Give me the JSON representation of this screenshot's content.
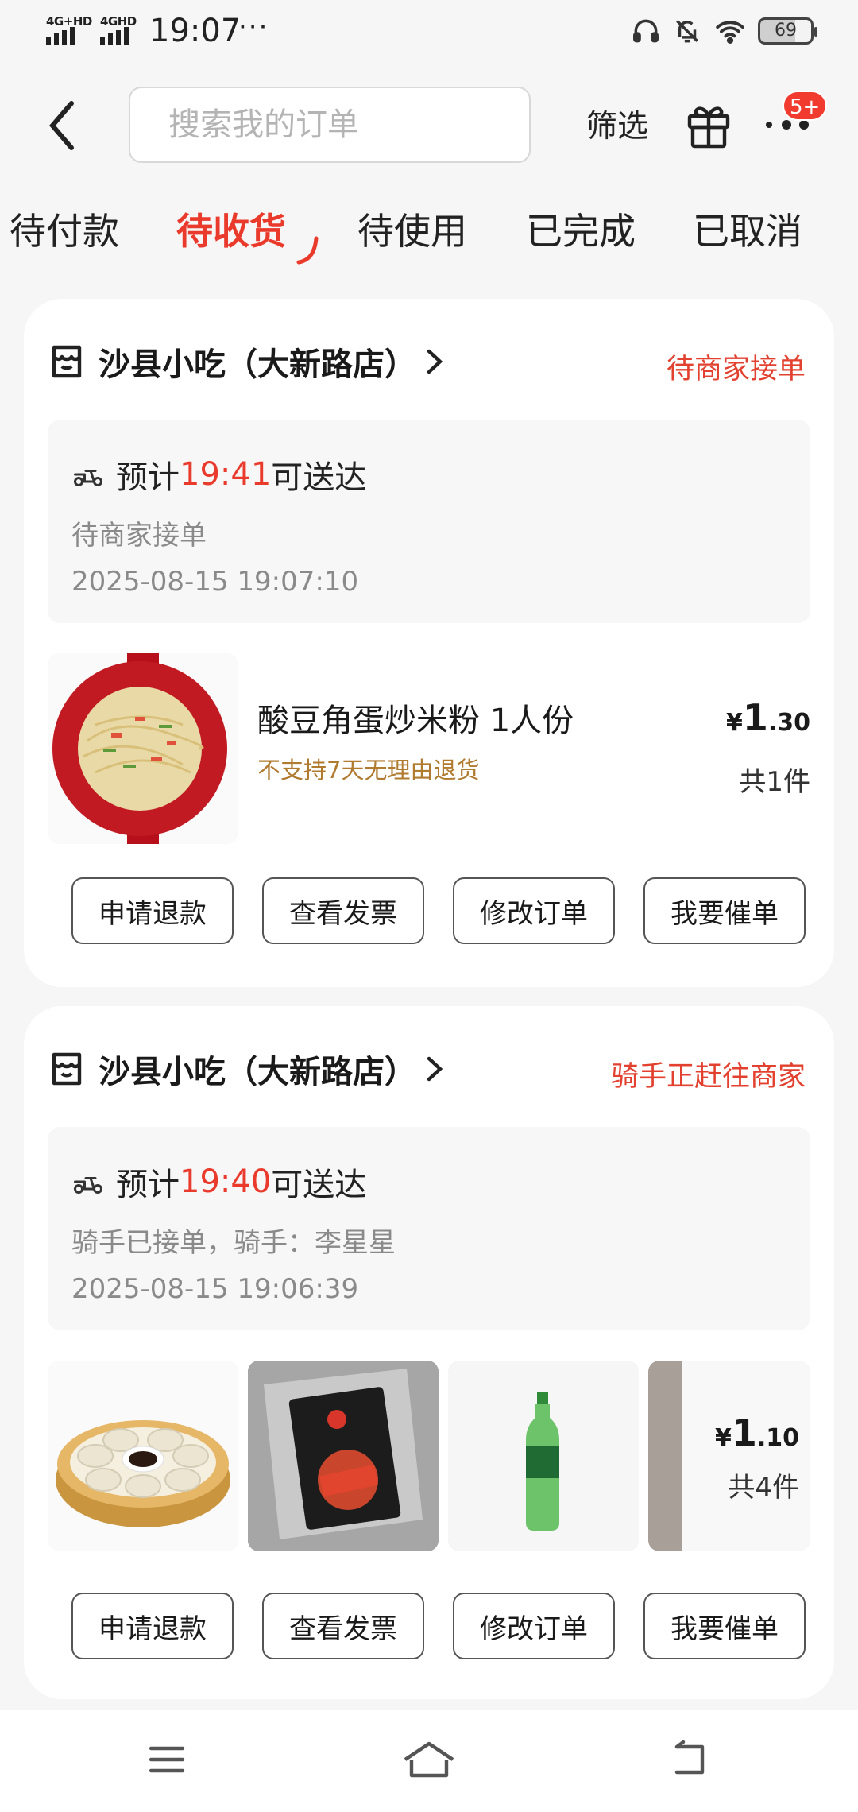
{
  "status_bar": {
    "network1": "4G+HD",
    "network2": "4GHD",
    "time": "19:07",
    "more": "···",
    "battery": "69",
    "battery_level": 0.69,
    "icons": [
      "headphones-icon",
      "bell-off-icon",
      "wifi-icon",
      "battery-icon"
    ]
  },
  "header": {
    "search_placeholder": "搜索我的订单",
    "filter_label": "筛选",
    "more_badge": "5+"
  },
  "tabs": [
    {
      "label": "待付款",
      "active": false
    },
    {
      "label": "待收货",
      "active": true
    },
    {
      "label": "待使用",
      "active": false
    },
    {
      "label": "已完成",
      "active": false
    },
    {
      "label": "已取消",
      "active": false
    }
  ],
  "orders": [
    {
      "shop_name": "沙县小吃（大新路店）",
      "status": "待商家接单",
      "eta_prefix": "预计",
      "eta_time": "19:41",
      "eta_suffix": "可送达",
      "sub_status": "待商家接单",
      "order_time": "2025-08-15 19:07:10",
      "item_name": "酸豆角蛋炒米粉 1人份",
      "item_note": "不支持7天无理由退货",
      "price_currency": "¥",
      "price_int": "1",
      "price_dec": ".30",
      "count": "共1件",
      "buttons": [
        "申请退款",
        "查看发票",
        "修改订单",
        "我要催单"
      ]
    },
    {
      "shop_name": "沙县小吃（大新路店）",
      "status": "骑手正赶往商家",
      "eta_prefix": "预计",
      "eta_time": "19:40",
      "eta_suffix": "可送达",
      "sub_status": "骑手已接单，骑手：李星星",
      "order_time": "2025-08-15 19:06:39",
      "price_currency": "¥",
      "price_int": "1",
      "price_dec": ".10",
      "count": "共4件",
      "buttons": [
        "申请退款",
        "查看发票",
        "修改订单",
        "我要催单"
      ]
    }
  ],
  "colors": {
    "accent": "#ea3a2c",
    "note": "#b07a2f",
    "background": "#f6f6f6"
  }
}
